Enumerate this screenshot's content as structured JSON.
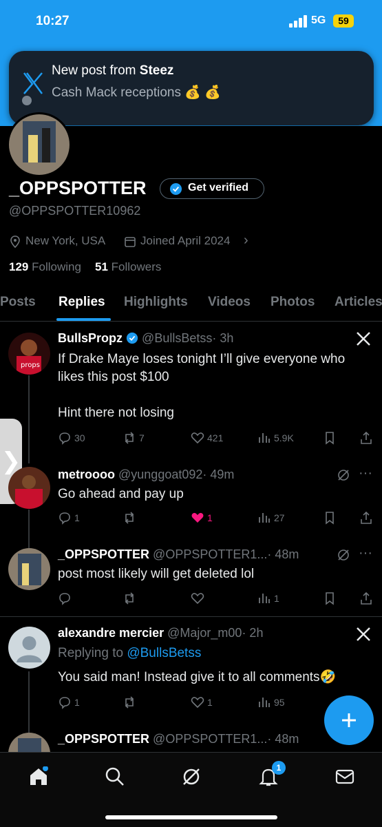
{
  "status": {
    "time": "10:27",
    "network": "5G",
    "battery": "59"
  },
  "notification": {
    "prefix": "New post from ",
    "sender": "Steez",
    "body": "Cash Mack receptions 💰 💰"
  },
  "profile": {
    "name": "_OPPSPOTTER",
    "get_verified": "Get verified",
    "handle": "@OPPSPOTTER10962",
    "location": "New York, USA",
    "joined": "Joined April 2024",
    "following_count": "129",
    "following_label": "Following",
    "followers_count": "51",
    "followers_label": "Followers"
  },
  "tabs": [
    "Posts",
    "Replies",
    "Highlights",
    "Videos",
    "Photos",
    "Articles"
  ],
  "posts": [
    {
      "name": "BullsPropz",
      "handle": "@BullsBetss",
      "time": "· 3h",
      "text": "If Drake Maye loses tonight I’ll give everyone who\nlikes this post $100\n\nHint there not losing",
      "replies": "30",
      "reposts": "7",
      "likes": "421",
      "views": "5.9K"
    },
    {
      "name": "metroooo",
      "handle": "@yunggoat092",
      "time": "· 49m",
      "text": "Go ahead and pay up",
      "replies": "1",
      "reposts": "",
      "likes": "1",
      "views": "27"
    },
    {
      "name": "_OPPSPOTTER",
      "handle": "@OPPSPOTTER1...",
      "time": "· 48m",
      "text": "post most likely will get deleted lol",
      "replies": "",
      "reposts": "",
      "likes": "",
      "views": "1"
    },
    {
      "name": "alexandre mercier",
      "handle": "@Major_m00",
      "time": "· 2h",
      "replying_prefix": "Replying to ",
      "replying_to": "@BullsBetss",
      "text": "You said man! Instead give it to all comments🤣",
      "replies": "1",
      "reposts": "",
      "likes": "1",
      "views": "95"
    },
    {
      "name": "_OPPSPOTTER",
      "handle": "@OPPSPOTTER1...",
      "time": "· 48m"
    }
  ],
  "nav": {
    "notification_badge": "1"
  },
  "colors": {
    "accent": "#1d9bf0",
    "like_active": "#f91880",
    "background": "#000000"
  }
}
